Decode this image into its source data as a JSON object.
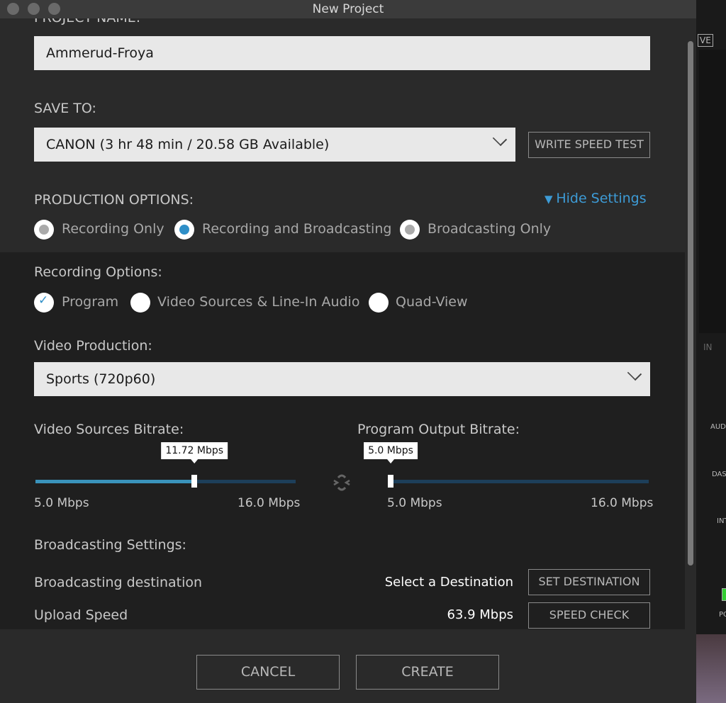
{
  "window": {
    "title": "New Project"
  },
  "project_name": {
    "label": "PROJECT NAME:",
    "value": "Ammerud-Froya"
  },
  "save_to": {
    "label": "SAVE TO:",
    "value": "CANON (3 hr 48 min / 20.58 GB Available)",
    "write_speed_test": "WRITE SPEED TEST"
  },
  "production": {
    "label": "PRODUCTION OPTIONS:",
    "hide_settings": "Hide Settings",
    "options": [
      {
        "label": "Recording Only",
        "selected": false
      },
      {
        "label": "Recording and Broadcasting",
        "selected": true
      },
      {
        "label": "Broadcasting Only",
        "selected": false
      }
    ]
  },
  "recording": {
    "label": "Recording Options:",
    "options": [
      {
        "label": "Program",
        "checked": true
      },
      {
        "label": "Video Sources & Line-In Audio",
        "checked": false
      },
      {
        "label": "Quad-View",
        "checked": false
      }
    ]
  },
  "video_production": {
    "label": "Video Production:",
    "value": "Sports (720p60)"
  },
  "bitrates": {
    "video_sources": {
      "label": "Video Sources Bitrate:",
      "value": 11.72,
      "value_label": "11.72 Mbps",
      "min": 5.0,
      "max": 16.0,
      "min_label": "5.0 Mbps",
      "max_label": "16.0 Mbps"
    },
    "program_output": {
      "label": "Program Output Bitrate:",
      "value": 5.0,
      "value_label": "5.0 Mbps",
      "min": 5.0,
      "max": 16.0,
      "min_label": "5.0 Mbps",
      "max_label": "16.0 Mbps"
    }
  },
  "broadcasting": {
    "label": "Broadcasting Settings:",
    "destination_label": "Broadcasting destination",
    "destination_value": "Select a Destination",
    "set_destination": "SET DESTINATION",
    "upload_label": "Upload Speed",
    "upload_value": "63.9 Mbps",
    "speed_check": "SPEED CHECK"
  },
  "footer": {
    "cancel": "CANCEL",
    "create": "CREATE"
  },
  "background_app": {
    "ve": "VE",
    "in": "IN",
    "aud": "AUD",
    "das": "DAS",
    "int": "INT",
    "po": "PO"
  },
  "colors": {
    "accent": "#3a93bb",
    "track": "#1d3f5a",
    "link": "#3d9bd6"
  }
}
